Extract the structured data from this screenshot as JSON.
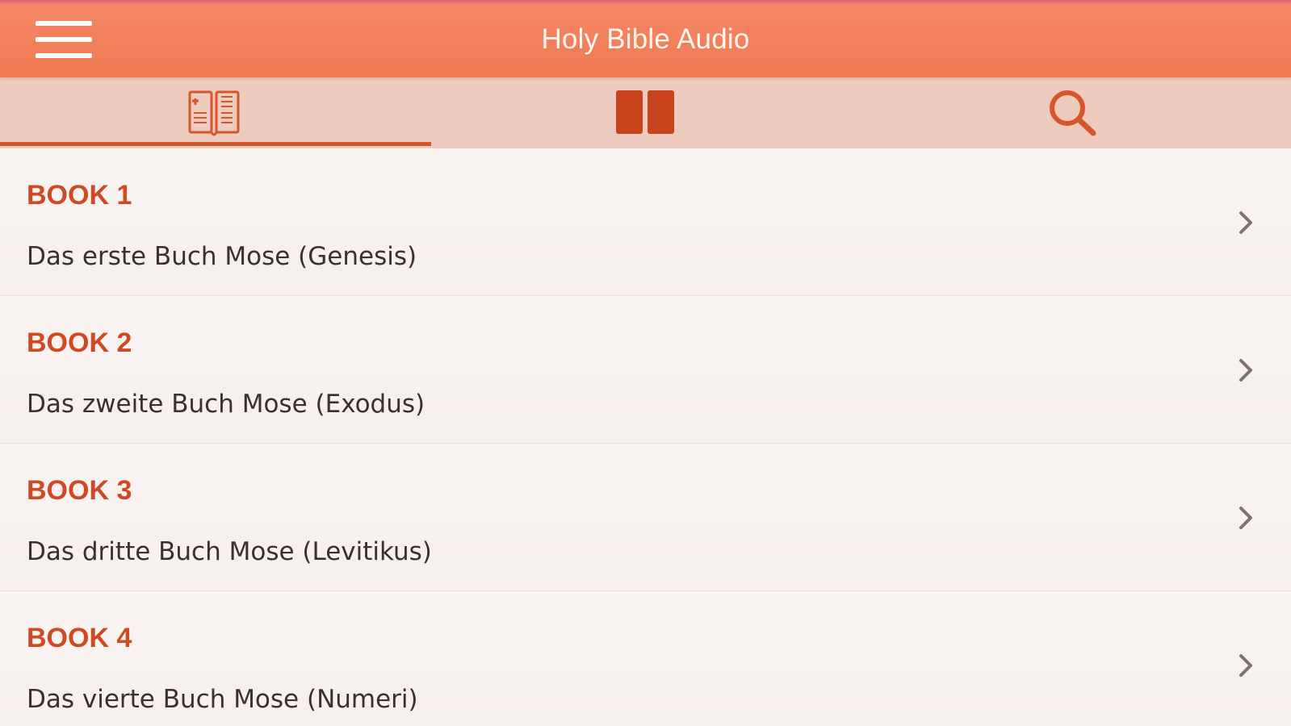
{
  "header": {
    "title": "Holy Bible Audio",
    "menu_icon": "hamburger-menu-icon"
  },
  "tabs": [
    {
      "icon": "bible-book-icon",
      "active": true
    },
    {
      "icon": "open-book-icon",
      "active": false
    },
    {
      "icon": "search-icon",
      "active": false
    }
  ],
  "books": [
    {
      "heading": "BOOK 1",
      "title": "Das erste Buch Mose (Genesis)"
    },
    {
      "heading": "BOOK 2",
      "title": "Das zweite Buch Mose (Exodus)"
    },
    {
      "heading": "BOOK 3",
      "title": "Das dritte Buch Mose (Levitikus)"
    },
    {
      "heading": "BOOK 4",
      "title": "Das vierte Buch Mose (Numeri)"
    }
  ],
  "colors": {
    "header_bg": "#f2835f",
    "tabbar_bg": "#edcbbf",
    "accent": "#d6562b",
    "heading_text": "#cf4a22",
    "body_text": "#3a302c"
  }
}
